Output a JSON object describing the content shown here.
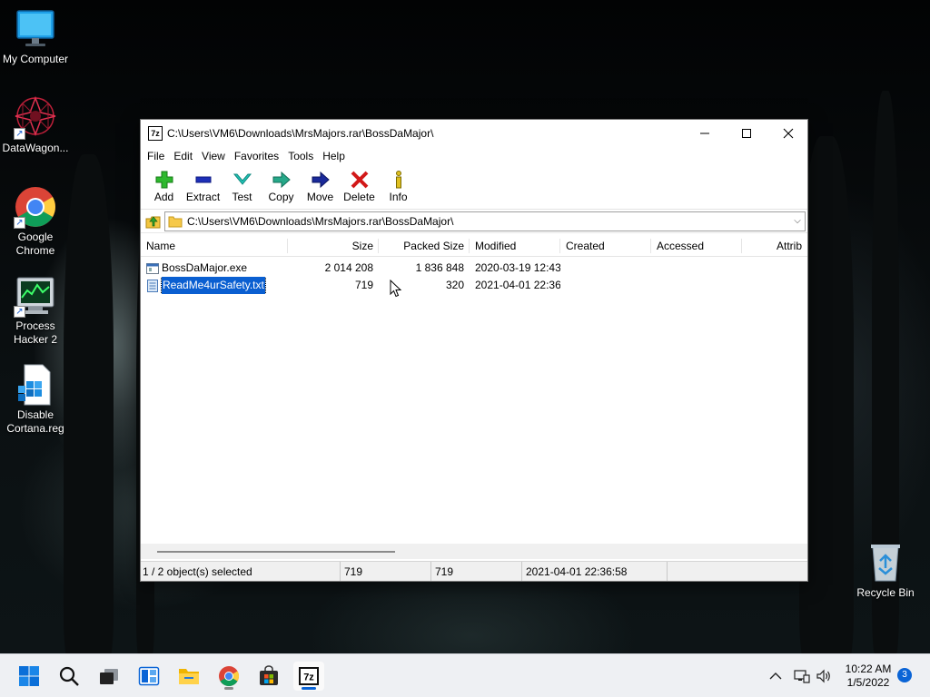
{
  "desktop": {
    "icons": [
      {
        "label": "My Computer"
      },
      {
        "label": "DataWagon..."
      },
      {
        "label": "Google Chrome"
      },
      {
        "label": "Process Hacker 2"
      },
      {
        "label": "Disable Cortana.reg"
      },
      {
        "label": "Recycle Bin"
      }
    ]
  },
  "window": {
    "app_icon_text": "7z",
    "title": "C:\\Users\\VM6\\Downloads\\MrsMajors.rar\\BossDaMajor\\",
    "menu": [
      "File",
      "Edit",
      "View",
      "Favorites",
      "Tools",
      "Help"
    ],
    "toolbar": [
      "Add",
      "Extract",
      "Test",
      "Copy",
      "Move",
      "Delete",
      "Info"
    ],
    "address": "C:\\Users\\VM6\\Downloads\\MrsMajors.rar\\BossDaMajor\\",
    "columns": [
      "Name",
      "Size",
      "Packed Size",
      "Modified",
      "Created",
      "Accessed",
      "Attrib"
    ],
    "files": [
      {
        "name": "BossDaMajor.exe",
        "size": "2 014 208",
        "packed": "1 836 848",
        "modified": "2020-03-19 12:43",
        "created": "",
        "accessed": "",
        "attrib": ""
      },
      {
        "name": "ReadMe4urSafety.txt",
        "size": "719",
        "packed": "320",
        "modified": "2021-04-01 22:36",
        "created": "",
        "accessed": "",
        "attrib": ""
      }
    ],
    "status": {
      "selection": "1 / 2 object(s) selected",
      "size": "719",
      "packed": "719",
      "modified": "2021-04-01 22:36:58"
    }
  },
  "taskbar": {
    "clock_time": "10:22 AM",
    "clock_date": "1/5/2022",
    "notification_count": "3"
  }
}
